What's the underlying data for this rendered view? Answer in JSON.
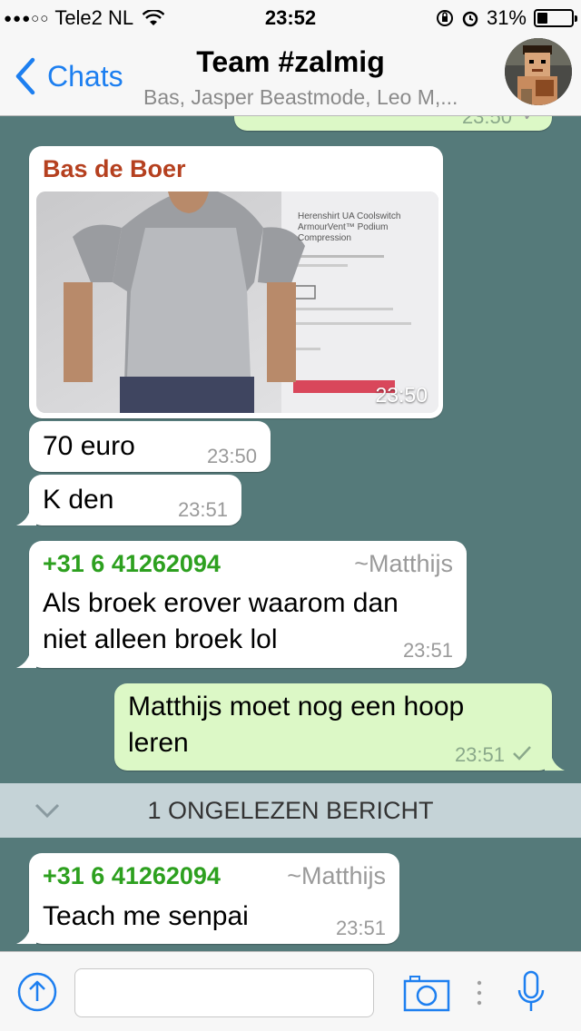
{
  "status_bar": {
    "signal": "●●●○○",
    "carrier": "Tele2 NL",
    "time": "23:52",
    "battery": "31%",
    "battery_level": 0.31
  },
  "header": {
    "back_label": "Chats",
    "title": "Team #zalmig",
    "subtitle": "Bas, Jasper Beastmode, Leo M,..."
  },
  "messages": [
    {
      "type": "outgoing-partial",
      "time": "23:50"
    },
    {
      "type": "image",
      "sender": "Bas de Boer",
      "sender_color": "#b5401f",
      "image_caption_lines": [
        "Herenshirt UA Coolswitch",
        "ArmourVent™ Podium",
        "Compression"
      ],
      "time": "23:50"
    },
    {
      "type": "incoming",
      "text": "70 euro",
      "time": "23:50"
    },
    {
      "type": "incoming",
      "text": "K den",
      "time": "23:51"
    },
    {
      "type": "incoming",
      "sender": "+31 6 41262094",
      "alias": "~Matthijs",
      "sender_color": "#2da01f",
      "lines": [
        "Als broek erover waarom dan",
        "niet alleen broek lol"
      ],
      "time": "23:51"
    },
    {
      "type": "outgoing",
      "lines": [
        "Matthijs moet nog een hoop",
        "leren"
      ],
      "time": "23:51"
    },
    {
      "type": "incoming",
      "sender": "+31 6 41262094",
      "alias": "~Matthijs",
      "sender_color": "#2da01f",
      "text": "Teach me senpai",
      "time": "23:51"
    }
  ],
  "unread_banner": "1 ONGELEZEN BERICHT",
  "input_bar": {
    "placeholder": "",
    "icons": [
      "upload-icon",
      "camera-icon",
      "microphone-icon"
    ]
  },
  "colors": {
    "chat_background": "#557a7a",
    "outgoing_bubble": "#dcf8c6",
    "incoming_bubble": "#ffffff",
    "accent": "#1d7ff0"
  }
}
